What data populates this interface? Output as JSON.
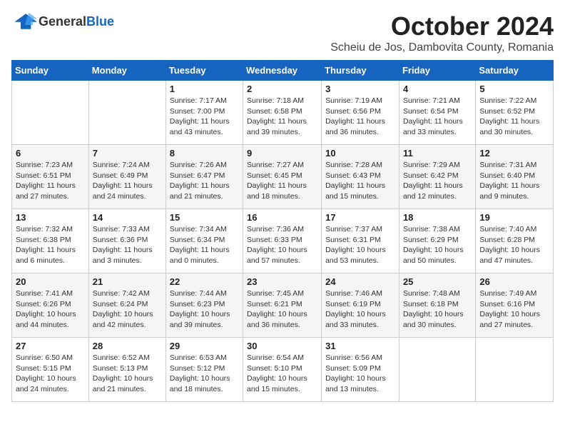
{
  "header": {
    "logo_general": "General",
    "logo_blue": "Blue",
    "title": "October 2024",
    "subtitle": "Scheiu de Jos, Dambovita County, Romania"
  },
  "weekdays": [
    "Sunday",
    "Monday",
    "Tuesday",
    "Wednesday",
    "Thursday",
    "Friday",
    "Saturday"
  ],
  "weeks": [
    [
      {
        "day": null,
        "detail": null
      },
      {
        "day": null,
        "detail": null
      },
      {
        "day": "1",
        "detail": "Sunrise: 7:17 AM\nSunset: 7:00 PM\nDaylight: 11 hours\nand 43 minutes."
      },
      {
        "day": "2",
        "detail": "Sunrise: 7:18 AM\nSunset: 6:58 PM\nDaylight: 11 hours\nand 39 minutes."
      },
      {
        "day": "3",
        "detail": "Sunrise: 7:19 AM\nSunset: 6:56 PM\nDaylight: 11 hours\nand 36 minutes."
      },
      {
        "day": "4",
        "detail": "Sunrise: 7:21 AM\nSunset: 6:54 PM\nDaylight: 11 hours\nand 33 minutes."
      },
      {
        "day": "5",
        "detail": "Sunrise: 7:22 AM\nSunset: 6:52 PM\nDaylight: 11 hours\nand 30 minutes."
      }
    ],
    [
      {
        "day": "6",
        "detail": "Sunrise: 7:23 AM\nSunset: 6:51 PM\nDaylight: 11 hours\nand 27 minutes."
      },
      {
        "day": "7",
        "detail": "Sunrise: 7:24 AM\nSunset: 6:49 PM\nDaylight: 11 hours\nand 24 minutes."
      },
      {
        "day": "8",
        "detail": "Sunrise: 7:26 AM\nSunset: 6:47 PM\nDaylight: 11 hours\nand 21 minutes."
      },
      {
        "day": "9",
        "detail": "Sunrise: 7:27 AM\nSunset: 6:45 PM\nDaylight: 11 hours\nand 18 minutes."
      },
      {
        "day": "10",
        "detail": "Sunrise: 7:28 AM\nSunset: 6:43 PM\nDaylight: 11 hours\nand 15 minutes."
      },
      {
        "day": "11",
        "detail": "Sunrise: 7:29 AM\nSunset: 6:42 PM\nDaylight: 11 hours\nand 12 minutes."
      },
      {
        "day": "12",
        "detail": "Sunrise: 7:31 AM\nSunset: 6:40 PM\nDaylight: 11 hours\nand 9 minutes."
      }
    ],
    [
      {
        "day": "13",
        "detail": "Sunrise: 7:32 AM\nSunset: 6:38 PM\nDaylight: 11 hours\nand 6 minutes."
      },
      {
        "day": "14",
        "detail": "Sunrise: 7:33 AM\nSunset: 6:36 PM\nDaylight: 11 hours\nand 3 minutes."
      },
      {
        "day": "15",
        "detail": "Sunrise: 7:34 AM\nSunset: 6:34 PM\nDaylight: 11 hours\nand 0 minutes."
      },
      {
        "day": "16",
        "detail": "Sunrise: 7:36 AM\nSunset: 6:33 PM\nDaylight: 10 hours\nand 57 minutes."
      },
      {
        "day": "17",
        "detail": "Sunrise: 7:37 AM\nSunset: 6:31 PM\nDaylight: 10 hours\nand 53 minutes."
      },
      {
        "day": "18",
        "detail": "Sunrise: 7:38 AM\nSunset: 6:29 PM\nDaylight: 10 hours\nand 50 minutes."
      },
      {
        "day": "19",
        "detail": "Sunrise: 7:40 AM\nSunset: 6:28 PM\nDaylight: 10 hours\nand 47 minutes."
      }
    ],
    [
      {
        "day": "20",
        "detail": "Sunrise: 7:41 AM\nSunset: 6:26 PM\nDaylight: 10 hours\nand 44 minutes."
      },
      {
        "day": "21",
        "detail": "Sunrise: 7:42 AM\nSunset: 6:24 PM\nDaylight: 10 hours\nand 42 minutes."
      },
      {
        "day": "22",
        "detail": "Sunrise: 7:44 AM\nSunset: 6:23 PM\nDaylight: 10 hours\nand 39 minutes."
      },
      {
        "day": "23",
        "detail": "Sunrise: 7:45 AM\nSunset: 6:21 PM\nDaylight: 10 hours\nand 36 minutes."
      },
      {
        "day": "24",
        "detail": "Sunrise: 7:46 AM\nSunset: 6:19 PM\nDaylight: 10 hours\nand 33 minutes."
      },
      {
        "day": "25",
        "detail": "Sunrise: 7:48 AM\nSunset: 6:18 PM\nDaylight: 10 hours\nand 30 minutes."
      },
      {
        "day": "26",
        "detail": "Sunrise: 7:49 AM\nSunset: 6:16 PM\nDaylight: 10 hours\nand 27 minutes."
      }
    ],
    [
      {
        "day": "27",
        "detail": "Sunrise: 6:50 AM\nSunset: 5:15 PM\nDaylight: 10 hours\nand 24 minutes."
      },
      {
        "day": "28",
        "detail": "Sunrise: 6:52 AM\nSunset: 5:13 PM\nDaylight: 10 hours\nand 21 minutes."
      },
      {
        "day": "29",
        "detail": "Sunrise: 6:53 AM\nSunset: 5:12 PM\nDaylight: 10 hours\nand 18 minutes."
      },
      {
        "day": "30",
        "detail": "Sunrise: 6:54 AM\nSunset: 5:10 PM\nDaylight: 10 hours\nand 15 minutes."
      },
      {
        "day": "31",
        "detail": "Sunrise: 6:56 AM\nSunset: 5:09 PM\nDaylight: 10 hours\nand 13 minutes."
      },
      {
        "day": null,
        "detail": null
      },
      {
        "day": null,
        "detail": null
      }
    ]
  ]
}
